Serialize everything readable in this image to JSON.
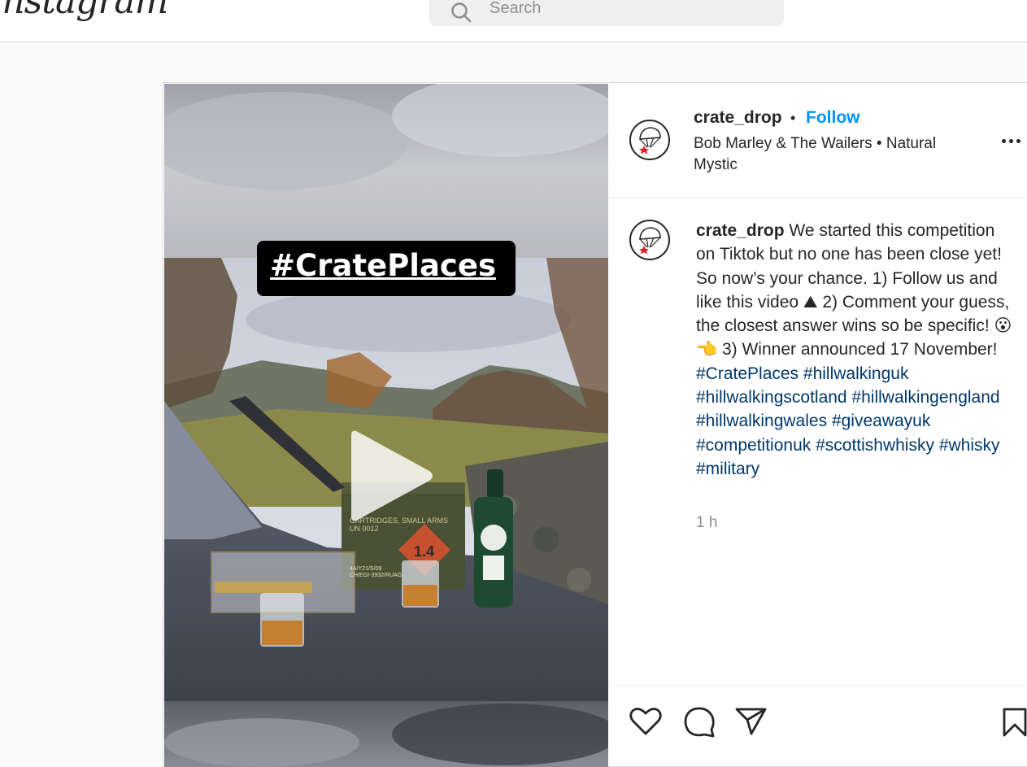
{
  "app": {
    "logo_text": "Instagram"
  },
  "search": {
    "placeholder": "Search"
  },
  "post": {
    "username": "crate_drop",
    "separator": "•",
    "follow_label": "Follow",
    "music": "Bob Marley & The Wailers • Natural Mystic",
    "overlay_text": "#CratePlaces",
    "caption": {
      "username": "crate_drop",
      "text": "We started this competition on Tiktok but no one has been close yet! So now’s your chance. 1) Follow us and like this video ⛰ 2) Comment your guess, the closest answer wins so be specific! 😮 👈 3) Winner announced 17 November!",
      "hashtags": [
        "#CratePlaces",
        "#hillwalkinguk",
        "#hillwalkingscotland",
        "#hillwalkingengland",
        "#hillwalkingwales",
        "#giveawayuk",
        "#competitionuk",
        "#scottishwhisky",
        "#whisky",
        "#military"
      ]
    },
    "timestamp": "1 h"
  },
  "icons": {
    "search": "search-icon",
    "more": "more-options-icon",
    "play": "play-icon",
    "like": "heart-icon",
    "comment": "comment-icon",
    "share": "paper-plane-icon",
    "save": "bookmark-icon",
    "avatar": "parachute-icon"
  },
  "colors": {
    "link": "#0095f6",
    "hashtag": "#00376b",
    "text": "#262626",
    "muted": "#8e8e8e",
    "overlay_bg": "#000000"
  }
}
